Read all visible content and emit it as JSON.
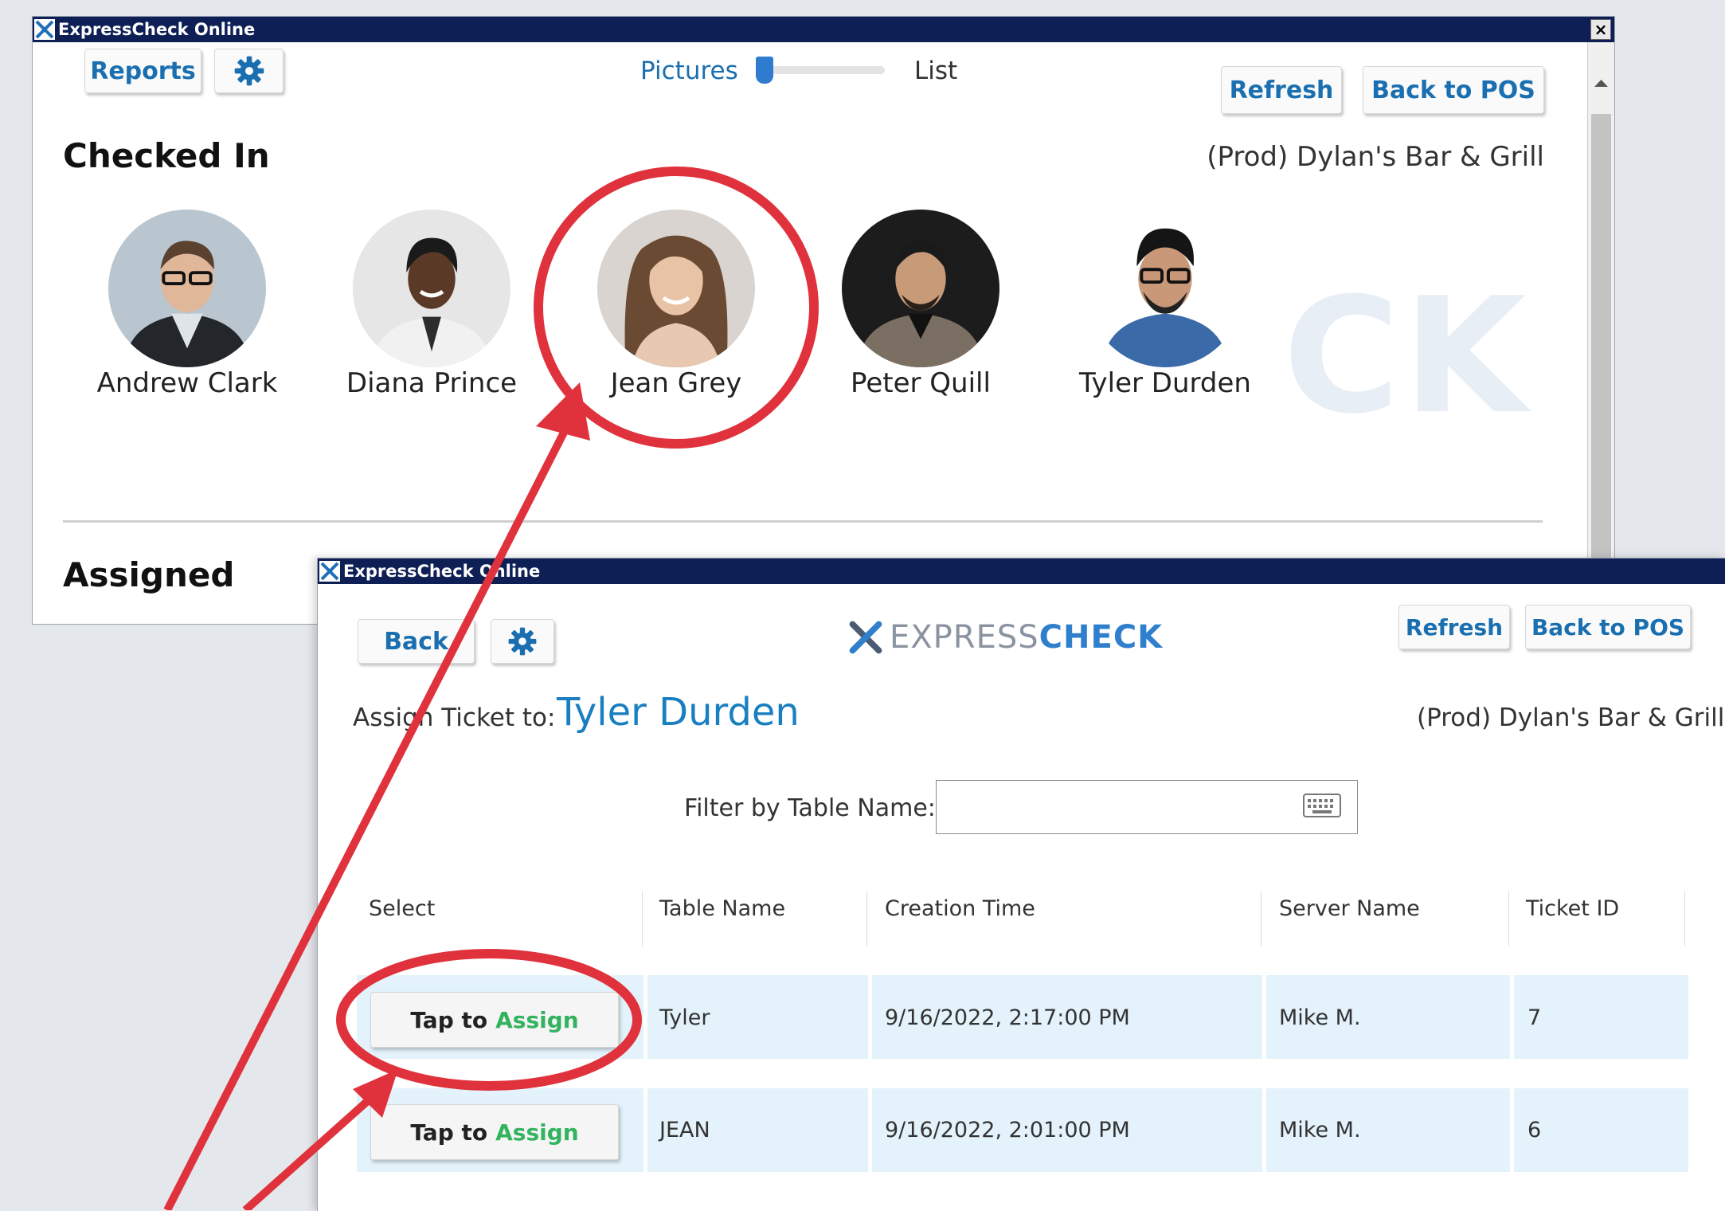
{
  "back_window": {
    "title": "ExpressCheck Online",
    "close_glyph": "×",
    "reports_label": "Reports",
    "view_toggle": {
      "left_label": "Pictures",
      "right_label": "List"
    },
    "refresh_label": "Refresh",
    "back_to_pos_label": "Back to POS",
    "checked_in_heading": "Checked In",
    "location": "(Prod) Dylan's Bar & Grill",
    "guests": [
      "Andrew Clark",
      "Diana Prince",
      "Jean Grey",
      "Peter Quill",
      "Tyler Durden"
    ],
    "watermark": "CK",
    "assigned_heading": "Assigned"
  },
  "front_window": {
    "title": "ExpressCheck Online",
    "back_label": "Back",
    "logo": {
      "light": "EXPRESS",
      "bold": "CHECK"
    },
    "refresh_label": "Refresh",
    "back_to_pos_label": "Back to POS",
    "assign_prefix": "Assign Ticket to:",
    "assign_name": "Tyler Durden",
    "location": "(Prod) Dylan's Bar & Grill",
    "filter_label": "Filter by Table Name:",
    "filter_value": "",
    "columns": [
      "Select",
      "Table Name",
      "Creation Time",
      "Server Name",
      "Ticket ID"
    ],
    "assign_button": {
      "tap": "Tap to",
      "assign": "Assign"
    },
    "rows": [
      {
        "table_name": "Tyler",
        "creation_time": "9/16/2022, 2:17:00 PM",
        "server_name": "Mike M.",
        "ticket_id": "7"
      },
      {
        "table_name": "JEAN",
        "creation_time": "9/16/2022, 2:01:00 PM",
        "server_name": "Mike M.",
        "ticket_id": "6"
      }
    ]
  },
  "colors": {
    "titlebar": "#0e1f55",
    "button_text": "#1a6fb0",
    "name_blue": "#1a7fc0",
    "assign_green": "#33b35f",
    "row_highlight": "#e3f2fb",
    "annotation_red": "#e0323c"
  },
  "icons": [
    "expresscheck-x-icon",
    "gear-icon",
    "keyboard-icon",
    "scroll-up-icon"
  ]
}
